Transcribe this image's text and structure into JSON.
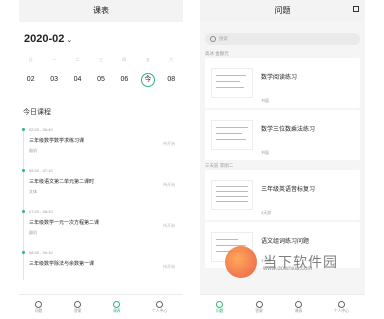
{
  "left": {
    "title": "课表",
    "month": "2020-02",
    "weekdays": [
      "日",
      "一",
      "二",
      "三",
      "四",
      "五",
      "六"
    ],
    "dates": [
      "02",
      "03",
      "04",
      "05",
      "06",
      "今",
      "08"
    ],
    "selected_index": 5,
    "section_title": "今日课程",
    "courses": [
      {
        "time": "02:00 - 06:40",
        "name": "三年级数学数学求练习课",
        "sub": "副机",
        "badge": "待开始"
      },
      {
        "time": "06:20 - 07:10",
        "name": "三年级语文第二单元第二课时",
        "sub": "文体",
        "badge": "待开始"
      },
      {
        "time": "07:20 - 08:10",
        "name": "三年级数学一元一次方程第二课",
        "sub": "副机",
        "badge": "待开始"
      },
      {
        "time": "08:30 - 09:10",
        "name": "三年级数学除法与余数第一课",
        "sub": "",
        "badge": "待开始"
      }
    ],
    "tabs": [
      "问题",
      "答案",
      "课表",
      "个人中心"
    ]
  },
  "right": {
    "title": "问题",
    "search_placeholder": "搜索",
    "groups": [
      {
        "label": "高冰 金额元",
        "cards": [
          {
            "title": "数学阅读练习",
            "meta": "书面"
          },
          {
            "title": "数学三位数乘法练习",
            "meta": "书面"
          }
        ]
      },
      {
        "label": "三天前 李刚二",
        "cards": [
          {
            "title": "三年级英语音标复习",
            "meta": "3天前"
          },
          {
            "title": "语文组词练习问题",
            "meta": "3天前"
          }
        ]
      }
    ],
    "tabs": [
      "问题",
      "答案",
      "课表",
      "个人中心"
    ]
  },
  "watermark": {
    "text": "当下软件园",
    "url": "www.downxia.com"
  }
}
